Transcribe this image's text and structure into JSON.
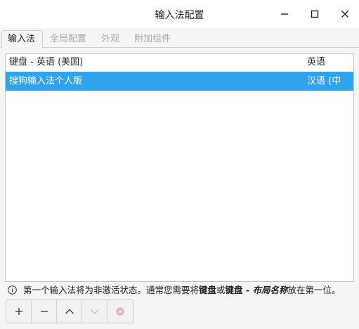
{
  "window": {
    "title": "输入法配置"
  },
  "tabs": [
    {
      "label": "输入法",
      "active": true
    },
    {
      "label": "全局配置",
      "active": false
    },
    {
      "label": "外观",
      "active": false
    },
    {
      "label": "附加组件",
      "active": false
    }
  ],
  "list": {
    "header": {
      "name": "键盘 - 英语 (美国)",
      "language": "英语"
    },
    "rows": [
      {
        "name": "搜狗输入法个人版",
        "language": "汉语 (中国)",
        "selected": true
      }
    ]
  },
  "info": {
    "text_1": "第一个输入法将为非激活状态。通常您需要将",
    "bold_1": "键盘",
    "text_2": "或",
    "bold_2": "键盘 - ",
    "italic_bold": "布局名称",
    "text_3": "放在第一位。"
  },
  "toolbar": {
    "buttons": [
      {
        "icon": "plus-icon",
        "enabled": true
      },
      {
        "icon": "minus-icon",
        "enabled": true
      },
      {
        "icon": "chevron-up-icon",
        "enabled": true
      },
      {
        "icon": "chevron-down-icon",
        "enabled": false
      },
      {
        "icon": "configure-icon",
        "enabled": true
      }
    ]
  },
  "colors": {
    "selection": "#31a3ec",
    "window_bg": "#f5f5f5"
  }
}
